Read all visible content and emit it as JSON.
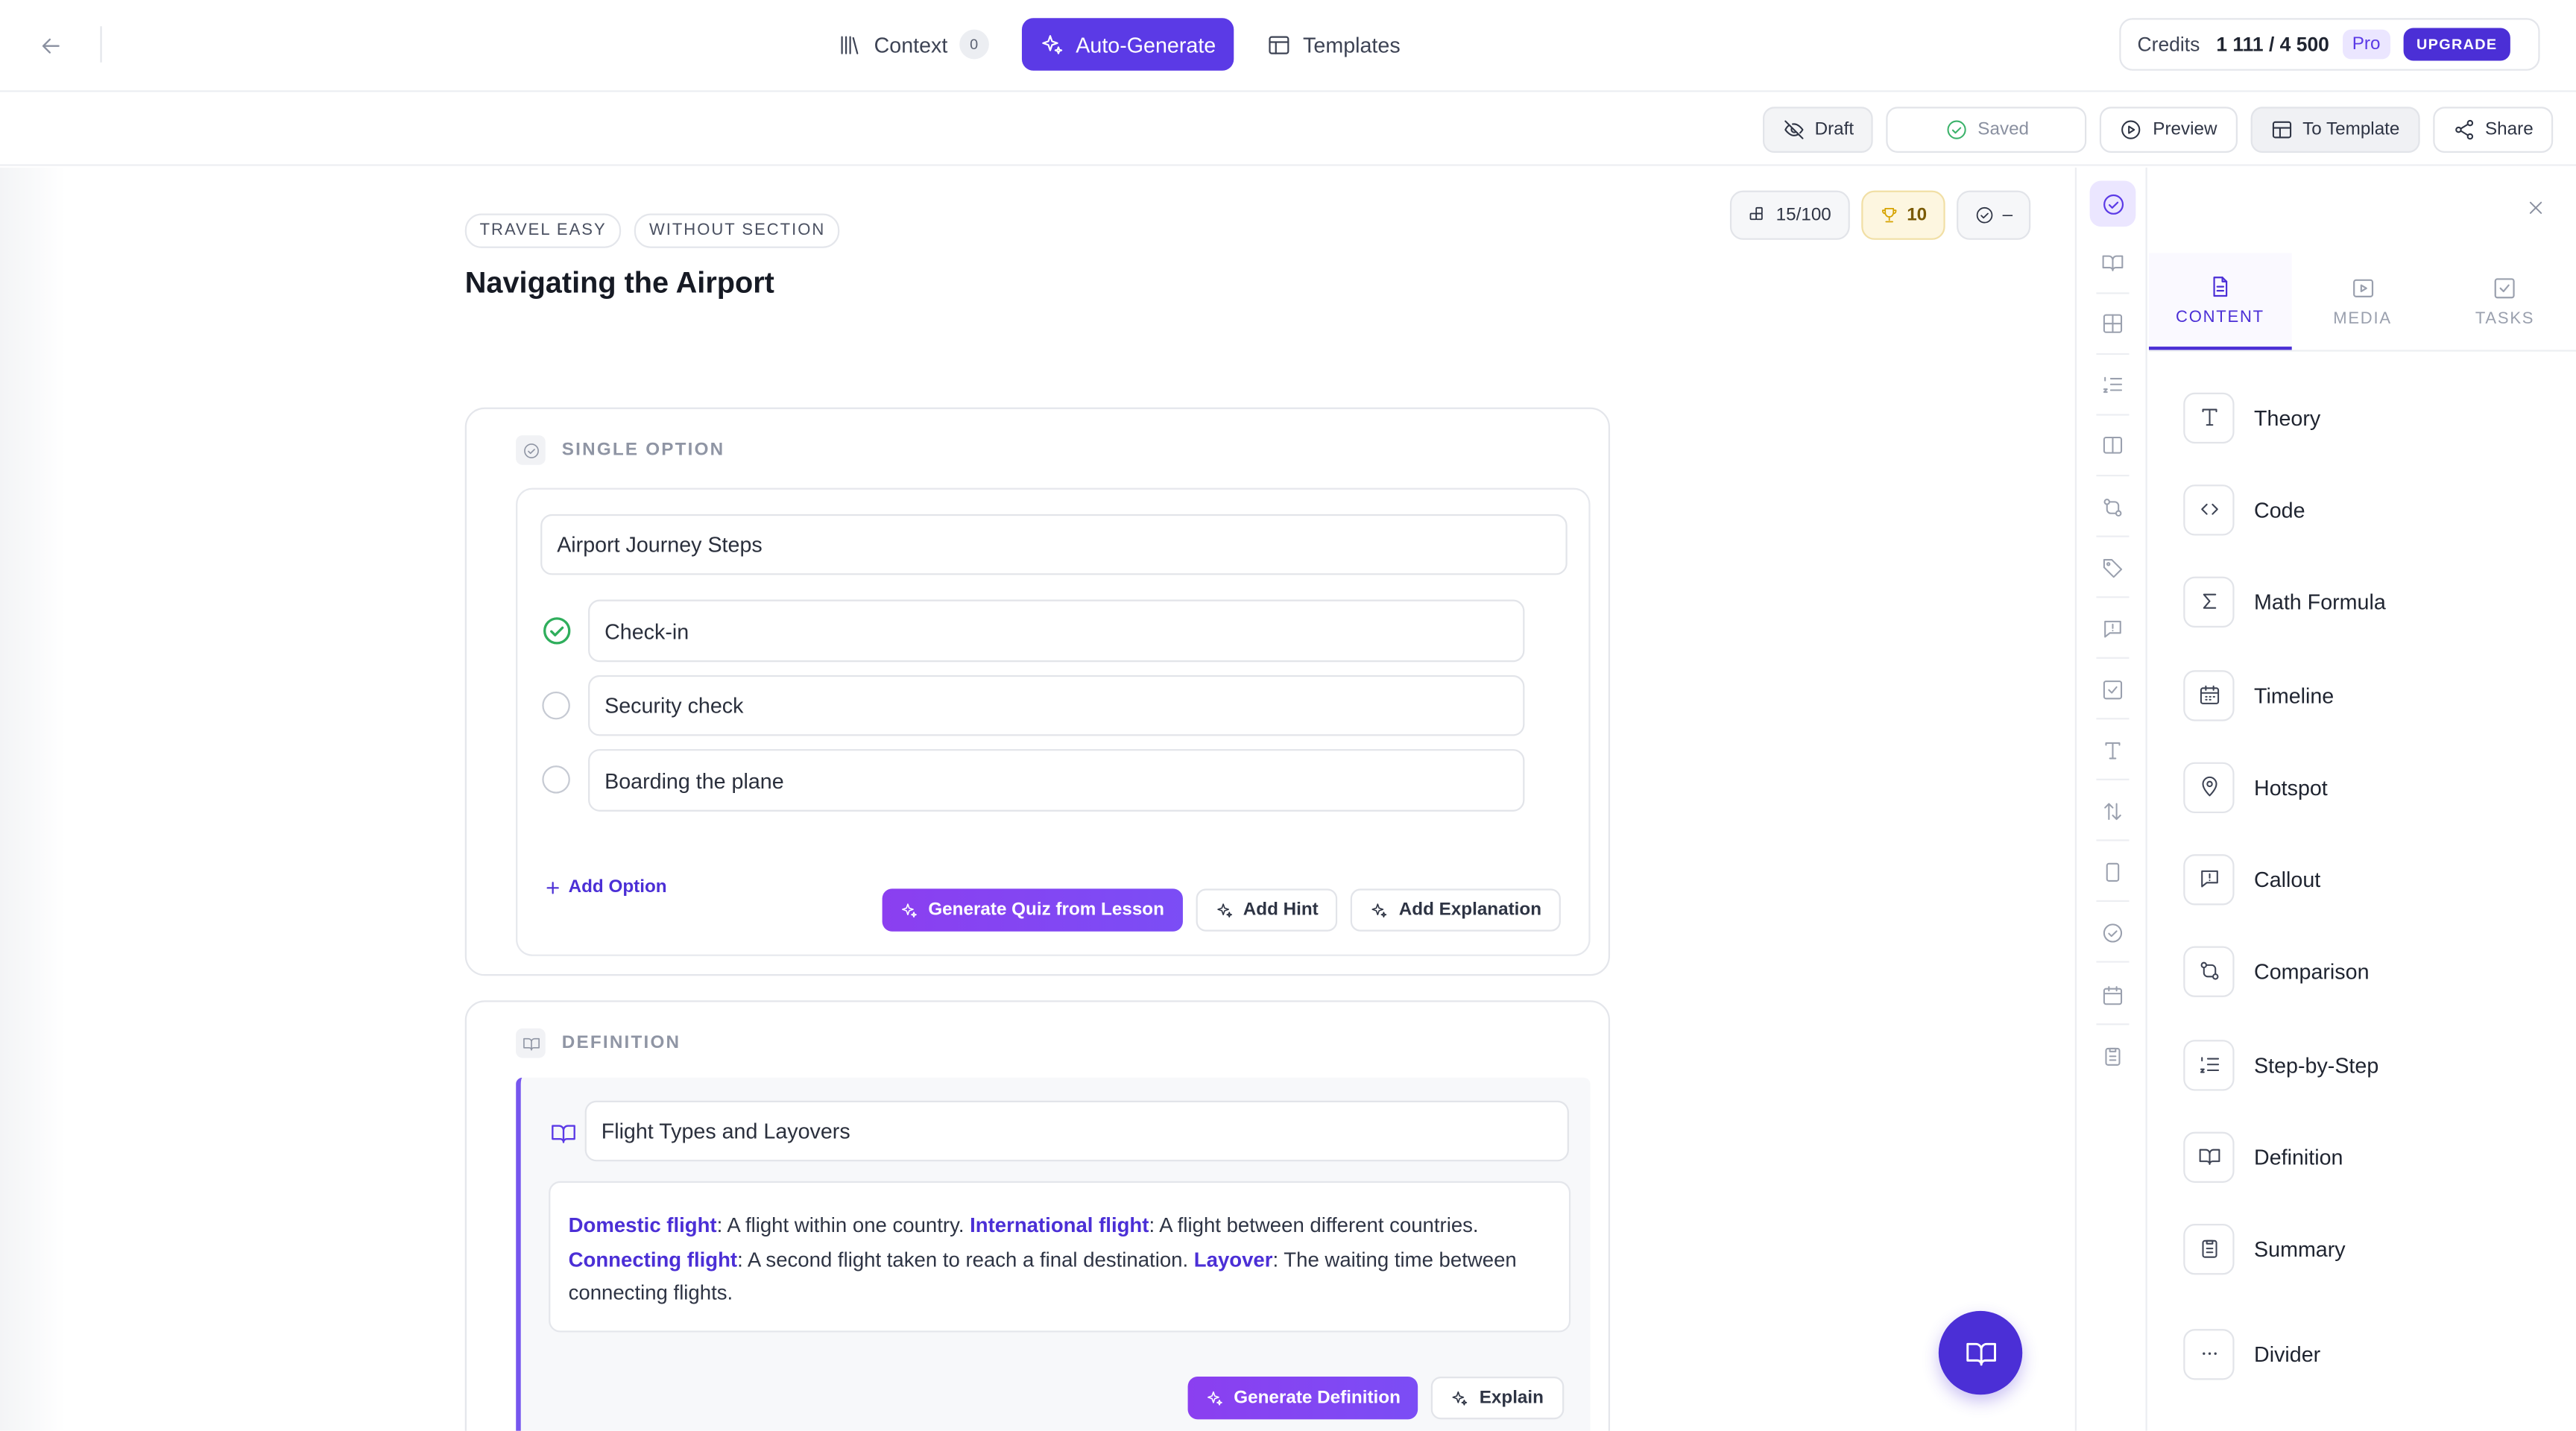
{
  "topbar": {
    "tabs": [
      {
        "label": "Context",
        "badge": "0",
        "icon": "library-icon"
      },
      {
        "label": "Auto-Generate",
        "icon": "sparkles-icon",
        "active": true
      },
      {
        "label": "Templates",
        "icon": "layout-icon"
      }
    ],
    "credits": {
      "label": "Credits",
      "value": "1 111 / 4 500",
      "plan": "Pro",
      "upgrade": "UPGRADE"
    }
  },
  "toolbar": {
    "draft": "Draft",
    "saved": "Saved",
    "preview": "Preview",
    "to_template": "To Template",
    "share": "Share"
  },
  "lesson": {
    "tags": [
      "TRAVEL EASY",
      "WITHOUT SECTION"
    ],
    "title": "Navigating the Airport",
    "stats": {
      "blocks": "15/100",
      "score": "10",
      "check": "–"
    }
  },
  "quiz": {
    "type_label": "SINGLE OPTION",
    "question": "Airport Journey Steps",
    "options": [
      {
        "text": "Check-in",
        "correct": true
      },
      {
        "text": "Security check",
        "correct": false
      },
      {
        "text": "Boarding the plane",
        "correct": false
      }
    ],
    "add_option": "Add Option",
    "generate": "Generate Quiz from Lesson",
    "add_hint": "Add Hint",
    "add_explanation": "Add Explanation"
  },
  "definition": {
    "type_label": "DEFINITION",
    "title": "Flight Types and Layovers",
    "terms": [
      {
        "term": "Domestic flight",
        "desc": ": A flight within one country. "
      },
      {
        "term": "International flight",
        "desc": ": A flight between different countries. "
      },
      {
        "term": "Connecting flight",
        "desc": ": A second flight taken to reach a final destination. "
      },
      {
        "term": "Layover",
        "desc": ": The waiting time between connecting flights."
      }
    ],
    "generate": "Generate Definition",
    "explain": "Explain"
  },
  "panel": {
    "tabs": [
      {
        "label": "CONTENT",
        "active": true
      },
      {
        "label": "MEDIA",
        "active": false
      },
      {
        "label": "TASKS",
        "active": false
      }
    ],
    "blocks": [
      "Theory",
      "Code",
      "Math Formula",
      "Timeline",
      "Hotspot",
      "Callout",
      "Comparison",
      "Step-by-Step",
      "Definition",
      "Summary",
      "Divider"
    ]
  },
  "colors": {
    "accent": "#5b3ae6",
    "accent_dark": "#4b2fd6",
    "success": "#2fae5c",
    "gradient_from": "#8b3ff0"
  }
}
